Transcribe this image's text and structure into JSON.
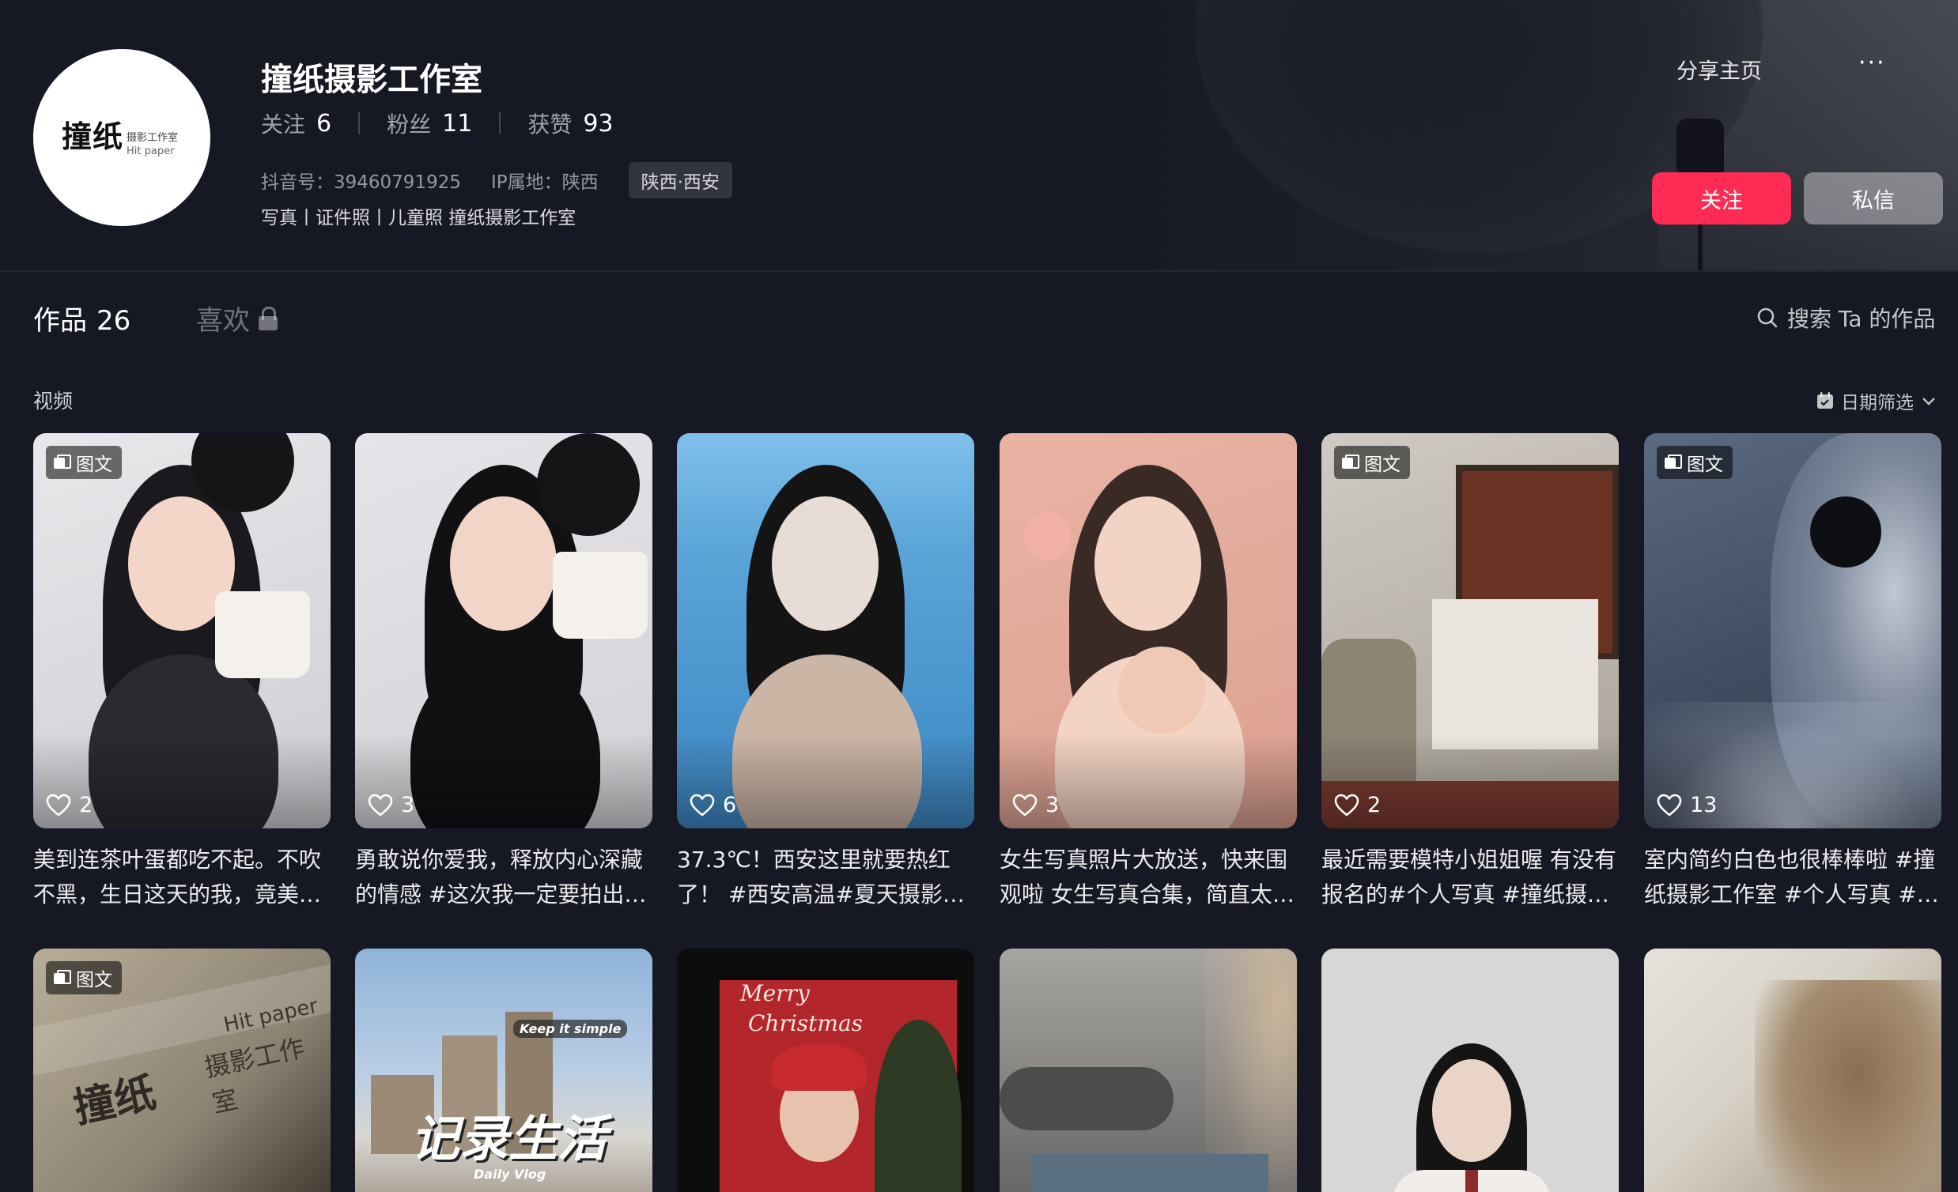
{
  "profile": {
    "name": "撞纸摄影工作室",
    "avatar_logo": "撞纸",
    "avatar_sub": "摄影工作室",
    "avatar_sub2": "Hit paper",
    "stats": [
      {
        "label": "关注",
        "value": "6"
      },
      {
        "label": "粉丝",
        "value": "11"
      },
      {
        "label": "获赞",
        "value": "93"
      }
    ],
    "douyin_id": "抖音号：39460791925",
    "ip_location": "IP属地：陕西",
    "location_chip": "陕西·西安",
    "bio": "写真丨证件照丨儿童照 撞纸摄影工作室"
  },
  "actions": {
    "share_label": "分享主页",
    "more_label": "···",
    "follow_label": "关注",
    "message_label": "私信"
  },
  "tabs": {
    "works_label": "作品",
    "works_count": "26",
    "likes_label": "喜欢"
  },
  "search": {
    "placeholder": "搜索 Ta 的作品"
  },
  "section": {
    "label": "视频"
  },
  "date_filter": {
    "label": "日期筛选"
  },
  "tag_label": "图文",
  "videos": [
    {
      "likes": "2",
      "tag": true,
      "caption": "美到连茶叶蛋都吃不起。不吹不黑，生日这天的我，竟美…",
      "palette": [
        "#e9e7ea",
        "#cfcdd2",
        "#1a1a1e",
        "#f3d6c8",
        "#2a2a30"
      ]
    },
    {
      "likes": "3",
      "tag": false,
      "caption": "勇敢说你爱我，释放内心深藏的情感 #这次我一定要拍出…",
      "palette": [
        "#e6e4e8",
        "#d4d2d6",
        "#111114",
        "#f1d5c7",
        "#151518"
      ]
    },
    {
      "likes": "6",
      "tag": false,
      "caption": "37.3℃！西安这里就要热红了！ #西安高温#夏天摄影#…",
      "palette": [
        "#5aa4d8",
        "#3d88c4",
        "#141414",
        "#e7dcd6",
        "#cbb5a5"
      ]
    },
    {
      "likes": "3",
      "tag": false,
      "caption": "女生写真照片大放送，快来围观啦 女生写真合集，简直太…",
      "palette": [
        "#e9b3a3",
        "#dca090",
        "#3a2a25",
        "#f3d3c4",
        "#efc8b6"
      ]
    },
    {
      "likes": "2",
      "tag": true,
      "caption": "最近需要模特小姐姐喔 有没有报名的#个人写真 #撞纸摄…",
      "palette": [
        "#cfcac2",
        "#a8a298",
        "#6b3324",
        "#e9e5de",
        "#8a4a3a"
      ]
    },
    {
      "likes": "13",
      "tag": true,
      "caption": "室内简约白色也很棒棒啦 #撞纸摄影工作室 #个人写真 #…",
      "palette": [
        "#5a6a82",
        "#2c3444",
        "#141820",
        "#8b95a5",
        "#c0c8d4"
      ]
    }
  ],
  "videos_row2": [
    {
      "tag": true,
      "overlay_text": "撞纸",
      "overlay_text2": "摄影工作室",
      "overlay_text3": "Hit paper",
      "palette": [
        "#b8ad98",
        "#8b8272",
        "#3a352c"
      ]
    },
    {
      "tag": false,
      "overlay_text": "记录生活",
      "overlay_text2": "Keep it simple",
      "overlay_text3": "Daily Vlog",
      "palette": [
        "#8fb3d8",
        "#d9d7d2",
        "#9a8f80"
      ]
    },
    {
      "tag": false,
      "overlay_text": "Merry",
      "overlay_text2": "Christmas",
      "overlay_text3": "",
      "palette": [
        "#0d0d0e",
        "#b3262c",
        "#2d3a24"
      ]
    },
    {
      "tag": false,
      "overlay_text": "",
      "overlay_text2": "",
      "overlay_text3": "",
      "palette": [
        "#8d8b88",
        "#5f6061",
        "#c9b49a"
      ]
    },
    {
      "tag": false,
      "overlay_text": "",
      "overlay_text2": "",
      "overlay_text3": "",
      "palette": [
        "#d9d7d5",
        "#141414",
        "#f1ede9"
      ]
    },
    {
      "tag": false,
      "overlay_text": "",
      "overlay_text2": "",
      "overlay_text3": "",
      "palette": [
        "#d8d3c9",
        "#9d8c76",
        "#e6e2db"
      ]
    }
  ],
  "colors": {
    "background": "#161823",
    "follow_button": "#fe2c55",
    "message_button": "#5c5d63"
  }
}
